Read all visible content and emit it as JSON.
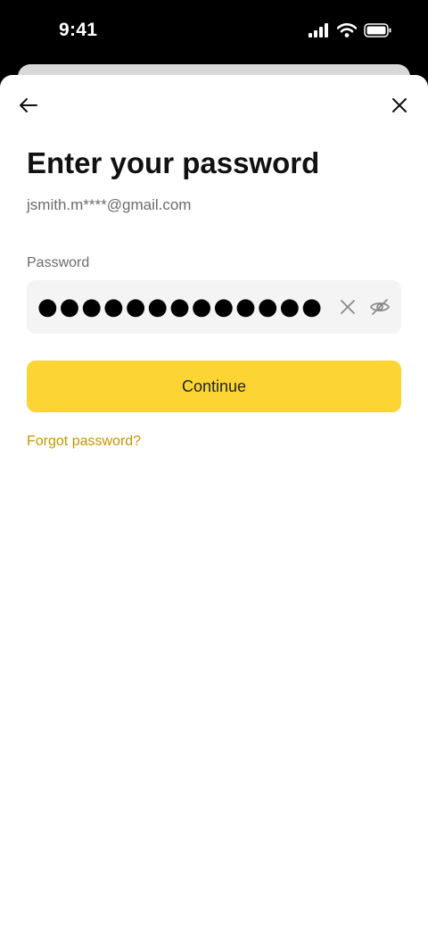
{
  "status_bar": {
    "time": "9:41",
    "icons": [
      "signal-icon",
      "wifi-icon",
      "battery-icon"
    ]
  },
  "nav": {
    "back_icon": "arrow-left-icon",
    "close_icon": "close-icon"
  },
  "page": {
    "title": "Enter your password",
    "email": "jsmith.m****@gmail.com"
  },
  "password_field": {
    "label": "Password",
    "value": "●●●●●●●●●●●●●●●",
    "clear_icon": "clear-icon",
    "visibility_icon": "eye-off-icon"
  },
  "actions": {
    "continue_label": "Continue",
    "forgot_label": "Forgot password?"
  },
  "colors": {
    "accent": "#fcd535",
    "link": "#c99400",
    "input_bg": "#f4f4f4"
  }
}
